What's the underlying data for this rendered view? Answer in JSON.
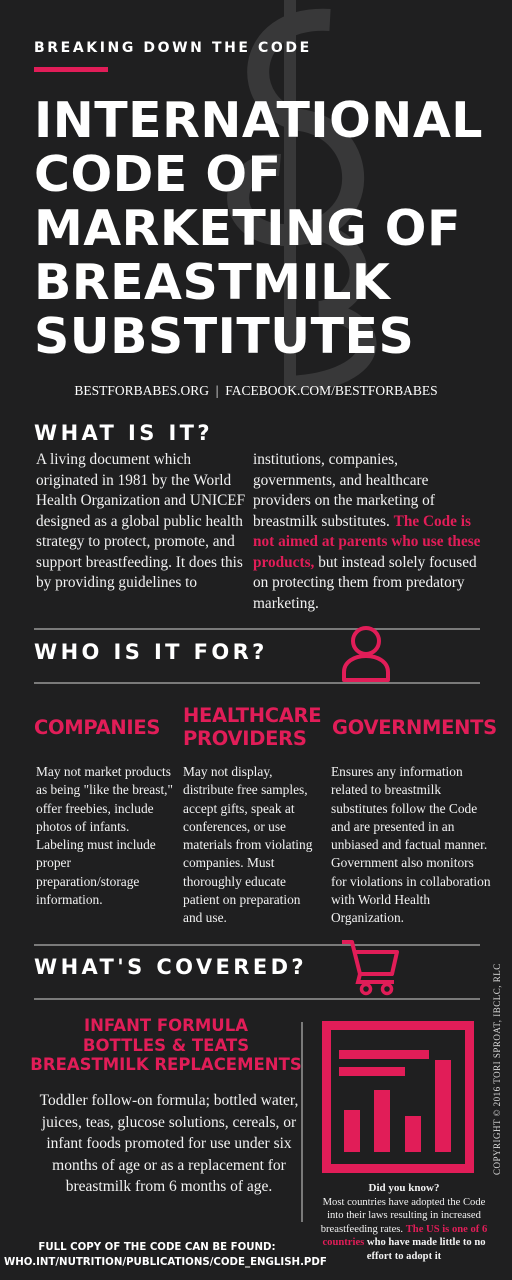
{
  "header": {
    "kicker": "BREAKING DOWN THE CODE",
    "title_lines": [
      "INTERNATIONAL",
      "CODE OF",
      "MARKETING OF",
      "BREASTMILK",
      "SUBSTITUTES"
    ],
    "links": "BESTFORBABES.ORG  |  FACEBOOK.COM/BESTFORBABES"
  },
  "what_is_it": {
    "heading": "WHAT IS IT?",
    "left_text": "A living document which originated in 1981 by the World Health Organization and UNICEF designed as a global public health strategy to protect, promote, and support breastfeeding. It does this by providing guidelines to",
    "right_text_1": "institutions, companies, governments, and healthcare providers on the marketing of breastmilk substitutes.",
    "right_highlight": "The Code is not aimed at parents who use these products,",
    "right_text_2": "but instead solely focused on protecting them from predatory marketing."
  },
  "who_is_it_for": {
    "heading": "WHO IS IT FOR?",
    "icon": "person-icon",
    "columns": [
      {
        "heading": "COMPANIES",
        "text": "May not market products as being \"like the breast,\" offer freebies, include photos of infants. Labeling must include proper preparation/storage information."
      },
      {
        "heading": "HEALTHCARE PROVIDERS",
        "text": "May not display, distribute free samples, accept gifts, speak at conferences, or use materials from violating companies. Must thoroughly educate patient on preparation and use."
      },
      {
        "heading": "GOVERNMENTS",
        "text": "Ensures any information related to breastmilk substitutes follow the Code and are presented in an unbiased and factual manner. Government also monitors for violations in collaboration with World Health Organization."
      }
    ]
  },
  "whats_covered": {
    "heading": "WHAT'S COVERED?",
    "icon": "shopping-cart-icon",
    "items": [
      "INFANT FORMULA",
      "BOTTLES & TEATS",
      "BREASTMILK REPLACEMENTS"
    ],
    "text": "Toddler follow-on formula; bottled water, juices, teas, glucose solutions, cereals, or infant foods promoted for use under six months of age or as a replacement for breastmilk from 6 months of age.",
    "chart_icon": "bar-chart-icon"
  },
  "did_you_know": {
    "title": "Did you know?",
    "text_1": "Most countries have adopted the Code into their laws resulting in increased breastfeeding rates.",
    "highlight": "The US is one of 6 countries",
    "text_2": "who have made little to no effort to adopt it"
  },
  "footer": {
    "line_1": "FULL COPY OF THE CODE CAN BE FOUND:",
    "line_2": "WHO.INT/NUTRITION/PUBLICATIONS/CODE_ENGLISH.PDF"
  },
  "copyright": "COPYRIGHT © 2016 TORI SPROAT, IBCLC, RLC",
  "colors": {
    "background": "#1f1f20",
    "accent": "#e11d58",
    "text": "#ffffff",
    "rule": "#7a7a7a"
  }
}
